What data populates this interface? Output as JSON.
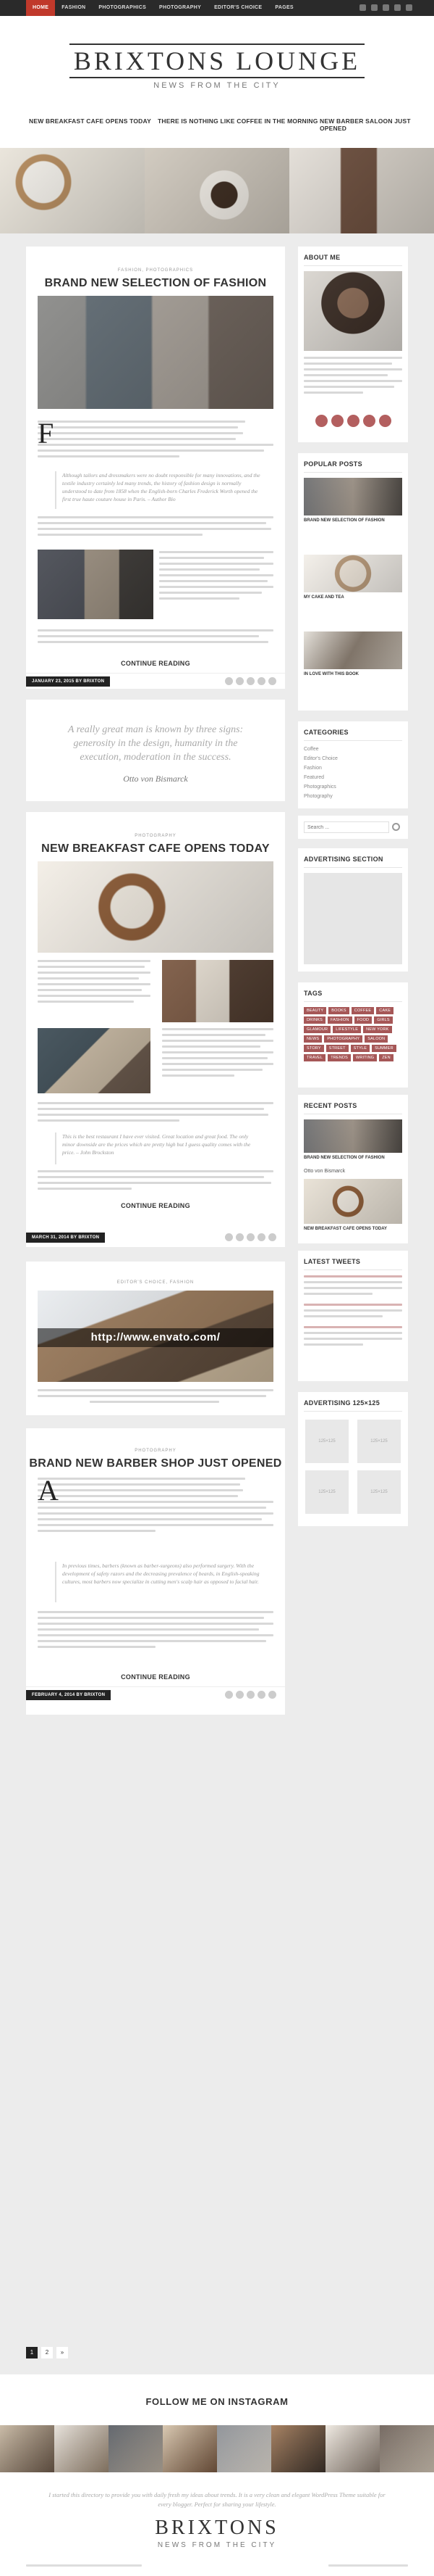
{
  "topnav": {
    "items": [
      "HOME",
      "FASHION",
      "PHOTOGRAPHICS",
      "PHOTOGRAPHY",
      "EDITOR'S CHOICE",
      "PAGES"
    ]
  },
  "header": {
    "title": "BRIXTONS LOUNGE",
    "tagline": "NEWS FROM THE CITY"
  },
  "slider": {
    "captions": [
      "NEW BREAKFAST CAFE OPENS TODAY",
      "THERE IS NOTHING LIKE COFFEE IN THE MORNING",
      "NEW BARBER SALOON JUST OPENED"
    ]
  },
  "posts": [
    {
      "category": "FASHION, PHOTOGRAPHICS",
      "title": "BRAND NEW SELECTION OF FASHION",
      "quote": "Although tailors and dressmakers were no doubt responsible for many innovations, and the textile industry certainly led many trends, the history of fashion design is normally understood to date from 1858 when the English-born Charles Frederick Worth opened the first true haute couture house in Paris. – Author Bio",
      "more": "CONTINUE READING",
      "date": "JANUARY 23, 2015 BY BRIXTON"
    },
    {
      "pullquote": "A really great man is known by three signs: generosity in the design, humanity in the execution, moderation in the success.",
      "author": "Otto von Bismarck"
    },
    {
      "category": "PHOTOGRAPHY",
      "title": "NEW BREAKFAST CAFE OPENS TODAY",
      "quote": "This is the best restaurant I have ever visited. Great location and great food. The only minor downside are the prices which are pretty high but I guess quality comes with the price. – John Brockston",
      "more": "CONTINUE READING",
      "date": "MARCH 31, 2014 BY BRIXTON"
    },
    {
      "category": "EDITOR'S CHOICE, FASHION",
      "link": "http://www.envato.com/"
    },
    {
      "category": "PHOTOGRAPHY",
      "title": "BRAND NEW BARBER SHOP JUST OPENED",
      "quote": "In previous times, barbers (known as barber-surgeons) also performed surgery. With the development of safety razors and the decreasing prevalence of beards, in English-speaking cultures, most barbers now specialize in cutting men's scalp hair as opposed to facial hair.",
      "more": "CONTINUE READING",
      "date": "FEBRUARY 4, 2014 BY BRIXTON"
    }
  ],
  "sidebar": {
    "about": {
      "title": "ABOUT ME"
    },
    "popular": {
      "title": "POPULAR POSTS",
      "items": [
        "BRAND NEW SELECTION OF FASHION",
        "MY CAKE AND TEA",
        "IN LOVE WITH THIS BOOK"
      ]
    },
    "categories": {
      "title": "CATEGORIES",
      "items": [
        "Coffee",
        "Editor's Choice",
        "Fashion",
        "Featured",
        "Photographics",
        "Photography"
      ]
    },
    "search": {
      "placeholder": "Search ..."
    },
    "ad": {
      "title": "ADVERTISING SECTION"
    },
    "tags": {
      "title": "TAGS",
      "items": [
        "BEAUTY",
        "BOOKS",
        "COFFEE",
        "CAKE",
        "DRINKS",
        "FASHION",
        "FOOD",
        "GIRLS",
        "GLAMOUR",
        "LIFESTYLE",
        "NEW YORK",
        "NEWS",
        "PHOTOGRAPHY",
        "SALOON",
        "STORY",
        "STREET",
        "STYLE",
        "SUMMER",
        "TRAVEL",
        "TRENDS",
        "WRITING",
        "ZEN"
      ]
    },
    "recent": {
      "title": "RECENT POSTS",
      "items": [
        "BRAND NEW SELECTION OF FASHION",
        "Otto von Bismarck",
        "NEW BREAKFAST CAFE OPENS TODAY"
      ]
    },
    "tweets": {
      "title": "LATEST TWEETS"
    },
    "ads125": {
      "title": "ADVERTISING 125×125",
      "slot": "125×125"
    }
  },
  "pagination": {
    "pages": [
      "1",
      "2",
      "»"
    ]
  },
  "footer": {
    "instagram_title": "FOLLOW ME ON INSTAGRAM",
    "quote": "I started this directory to provide you with daily fresh my ideas about trends. It is a very clean and elegant WordPress Theme suitable for every blogger. Perfect for sharing your lifestyle.",
    "logo": "BRIXTONS",
    "tagline": "NEWS FROM THE CITY"
  },
  "colors": {
    "accent": "#c0392b",
    "tag": "#a65757",
    "dark": "#222222"
  }
}
